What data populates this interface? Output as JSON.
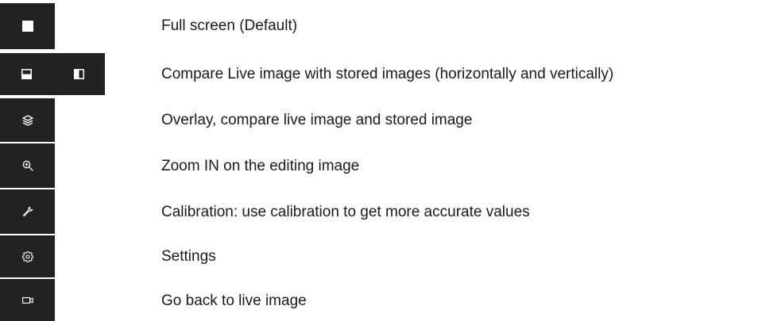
{
  "legend": {
    "items": [
      {
        "icon": "full-screen-icon",
        "label": "Full screen (Default)"
      },
      {
        "icon": "split-horizontal-icon",
        "icon2": "split-vertical-icon",
        "label": "Compare Live image with stored images (horizontally and vertically)"
      },
      {
        "icon": "layers-icon",
        "label": "Overlay, compare live image and stored image"
      },
      {
        "icon": "zoom-in-icon",
        "label": "Zoom IN on the editing image"
      },
      {
        "icon": "wrench-icon",
        "label": "Calibration: use calibration to get more accurate values"
      },
      {
        "icon": "gear-icon",
        "label": "Settings"
      },
      {
        "icon": "video-camera-icon",
        "label": "Go back to live image"
      }
    ]
  },
  "colors": {
    "tile_background": "#222222",
    "icon_color": "#ffffff",
    "text_color": "#1a1a1a"
  }
}
